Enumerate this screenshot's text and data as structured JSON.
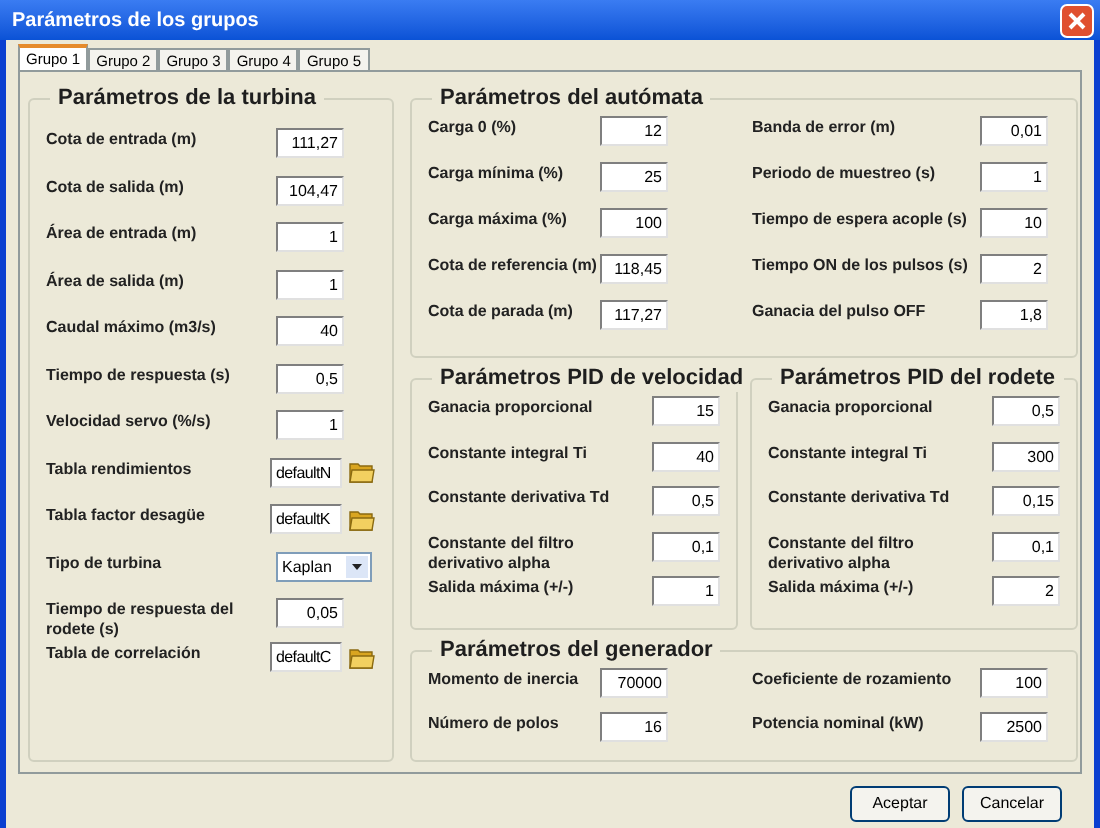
{
  "window": {
    "title": "Parámetros de los grupos"
  },
  "tabs": [
    {
      "label": "Grupo 1",
      "selected": true
    },
    {
      "label": "Grupo 2",
      "selected": false
    },
    {
      "label": "Grupo 3",
      "selected": false
    },
    {
      "label": "Grupo 4",
      "selected": false
    },
    {
      "label": "Grupo 5",
      "selected": false
    }
  ],
  "turbine_group": {
    "title": "Parámetros de la turbina",
    "fields": [
      {
        "label": "Cota de entrada (m)",
        "value": "111,27",
        "kind": "text"
      },
      {
        "label": "Cota de salida (m)",
        "value": "104,47",
        "kind": "text"
      },
      {
        "label": "Área de entrada (m)",
        "value": "1",
        "kind": "text"
      },
      {
        "label": "Área de salida (m)",
        "value": "1",
        "kind": "text"
      },
      {
        "label": "Caudal máximo (m3/s)",
        "value": "40",
        "kind": "text"
      },
      {
        "label": "Tiempo de respuesta (s)",
        "value": "0,5",
        "kind": "text"
      },
      {
        "label": "Velocidad servo (%/s)",
        "value": "1",
        "kind": "text"
      },
      {
        "label": "Tabla rendimientos",
        "value": "defaultN",
        "kind": "file"
      },
      {
        "label": "Tabla factor desagüe",
        "value": "defaultK",
        "kind": "file"
      },
      {
        "label": "Tipo de turbina",
        "value": "Kaplan",
        "kind": "select"
      },
      {
        "label": "Tiempo de respuesta del rodete (s)",
        "value": "0,05",
        "kind": "text"
      },
      {
        "label": "Tabla de correlación",
        "value": "defaultC",
        "kind": "file"
      }
    ]
  },
  "automaton_group": {
    "title": "Parámetros del autómata",
    "left_fields": [
      {
        "label": "Carga 0 (%)",
        "value": "12"
      },
      {
        "label": "Carga mínima (%)",
        "value": "25"
      },
      {
        "label": "Carga máxima (%)",
        "value": "100"
      },
      {
        "label": "Cota de referencia (m)",
        "value": "118,45"
      },
      {
        "label": "Cota de parada (m)",
        "value": "117,27"
      }
    ],
    "right_fields": [
      {
        "label": "Banda de error (m)",
        "value": "0,01"
      },
      {
        "label": "Periodo de muestreo (s)",
        "value": "1"
      },
      {
        "label": "Tiempo de espera acople (s)",
        "value": "10"
      },
      {
        "label": "Tiempo ON de los pulsos (s)",
        "value": "2"
      },
      {
        "label": "Ganacia del pulso OFF",
        "value": "1,8"
      }
    ]
  },
  "pid_speed_group": {
    "title": "Parámetros PID de velocidad",
    "fields": [
      {
        "label": "Ganacia proporcional",
        "value": "15"
      },
      {
        "label": "Constante integral Ti",
        "value": "40"
      },
      {
        "label": "Constante derivativa Td",
        "value": "0,5"
      },
      {
        "label": "Constante del filtro derivativo alpha",
        "value": "0,1"
      },
      {
        "label": "Salida máxima (+/-)",
        "value": "1"
      }
    ]
  },
  "pid_runner_group": {
    "title": "Parámetros PID del rodete",
    "fields": [
      {
        "label": "Ganacia proporcional",
        "value": "0,5"
      },
      {
        "label": "Constante integral Ti",
        "value": "300"
      },
      {
        "label": "Constante derivativa Td",
        "value": "0,15"
      },
      {
        "label": "Constante del filtro derivativo alpha",
        "value": "0,1"
      },
      {
        "label": "Salida máxima (+/-)",
        "value": "2"
      }
    ]
  },
  "generator_group": {
    "title": "Parámetros del generador",
    "left_fields": [
      {
        "label": "Momento de inercia",
        "value": "70000"
      },
      {
        "label": "Número de polos",
        "value": "16"
      }
    ],
    "right_fields": [
      {
        "label": "Coeficiente de rozamiento",
        "value": "100"
      },
      {
        "label": "Potencia nominal (kW)",
        "value": "2500"
      }
    ]
  },
  "buttons": [
    "Aceptar",
    "Cancelar"
  ]
}
